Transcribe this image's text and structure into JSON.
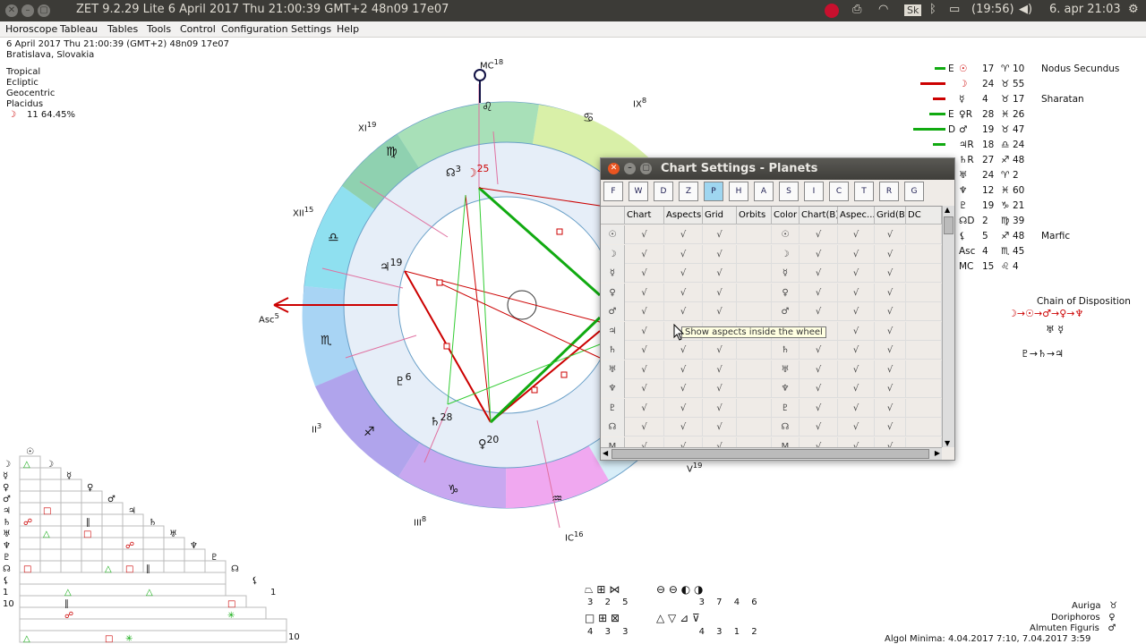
{
  "topbar": {
    "title": "ZET 9.2.29 Lite    6 April 2017  Thu   21:00:39 GMT+2 48n09  17e07",
    "battery": "(19:56)",
    "clock": "6. apr 21:03",
    "kb": "Sk"
  },
  "menu": [
    "Horoscope",
    "Tableau",
    "Tables",
    "Tools",
    "Control",
    "Configuration",
    "Settings",
    "Help"
  ],
  "info": {
    "line1": "6 April 2017  Thu   21:00:39 (GMT+2) 48n09  17e07",
    "line2": "Bratislava, Slovakia",
    "line3": "Tropical",
    "line4": "Ecliptic",
    "line5": "Geocentric",
    "line6": "Placidus",
    "line7": "11  64.45%",
    "moon": "☽"
  },
  "wheel": {
    "houses": [
      "MC",
      "XI",
      "XII",
      "Asc",
      "II",
      "III",
      "IC",
      "V",
      "IX"
    ],
    "house_deg": [
      "18",
      "19",
      "15",
      "5",
      "3",
      "8",
      "16",
      "19",
      "8"
    ],
    "signs": [
      "♌",
      "♋",
      "♍",
      "♎",
      "♏",
      "♐",
      "♑",
      "♒",
      "♓"
    ],
    "planets": [
      "☊",
      "☽",
      "♃",
      "♇",
      "♄",
      "♀"
    ],
    "planet_sub": [
      "3",
      "25",
      "19",
      "6",
      "28",
      "20"
    ]
  },
  "dialog": {
    "title": "Chart Settings - Planets",
    "tools": [
      "F",
      "W",
      "D",
      "Z",
      "P",
      "H",
      "A",
      "S",
      "I",
      "C",
      "T",
      "R",
      "G"
    ],
    "columns": [
      "Chart",
      "Aspects",
      "Grid",
      "Orbits",
      "Color",
      "Chart(B)",
      "Aspec...",
      "Grid(B)",
      "DC"
    ],
    "rows": [
      "☉",
      "☽",
      "☿",
      "♀",
      "♂",
      "♃",
      "♄",
      "♅",
      "♆",
      "♇",
      "☊",
      "M"
    ],
    "check": "√",
    "tooltip": "Show aspects inside the wheel"
  },
  "right": {
    "rows": [
      {
        "pre": "E",
        "g": "☉",
        "deg": "17",
        "s": "♈",
        "min": "10",
        "name": "Nodus Secundus"
      },
      {
        "pre": "",
        "g": "☽",
        "deg": "24",
        "s": "♉",
        "min": "55",
        "name": ""
      },
      {
        "pre": "",
        "g": "☿",
        "deg": "4",
        "s": "♉",
        "min": "17",
        "name": "Sharatan"
      },
      {
        "pre": "E",
        "g": "♀R",
        "deg": "28",
        "s": "♓",
        "min": "26",
        "name": ""
      },
      {
        "pre": "D",
        "g": "♂",
        "deg": "19",
        "s": "♉",
        "min": "47",
        "name": ""
      },
      {
        "pre": "",
        "g": "♃R",
        "deg": "18",
        "s": "♎",
        "min": "24",
        "name": ""
      },
      {
        "pre": "",
        "g": "♄R",
        "deg": "27",
        "s": "♐",
        "min": "48",
        "name": ""
      },
      {
        "pre": "",
        "g": "♅",
        "deg": "24",
        "s": "♈",
        "min": "2",
        "name": ""
      },
      {
        "pre": "",
        "g": "♆",
        "deg": "12",
        "s": "♓",
        "min": "60",
        "name": ""
      },
      {
        "pre": "",
        "g": "♇",
        "deg": "19",
        "s": "♑",
        "min": "21",
        "name": ""
      },
      {
        "pre": "",
        "g": "☊D",
        "deg": "2",
        "s": "♍",
        "min": "39",
        "name": ""
      },
      {
        "pre": "",
        "g": "⚸",
        "deg": "5",
        "s": "♐",
        "min": "48",
        "name": "Marfic"
      },
      {
        "pre": "",
        "g": "Asc",
        "deg": "4",
        "s": "♏",
        "min": "45",
        "name": ""
      },
      {
        "pre": "",
        "g": "MC",
        "deg": "15",
        "s": "♌",
        "min": "4",
        "name": ""
      }
    ],
    "chain_title": "Chain of Disposition",
    "chain1": "☽→☉→♂→♀→♆",
    "chain2": "♅   ☿",
    "chain3": "♇→♄→♃"
  },
  "bottom": {
    "row1": [
      "3",
      "2",
      "5",
      "3",
      "7",
      "4",
      "6"
    ],
    "row2": [
      "4",
      "3",
      "3",
      "4",
      "3",
      "1",
      "2"
    ],
    "fixed": [
      "Auriga",
      "Doriphoros",
      "Almuten Figuris"
    ],
    "fixed_g": [
      "♉",
      "♀",
      "♂"
    ],
    "algol": "Algol Minima: 4.04.2017  7:10,  7.04.2017  3:59"
  }
}
